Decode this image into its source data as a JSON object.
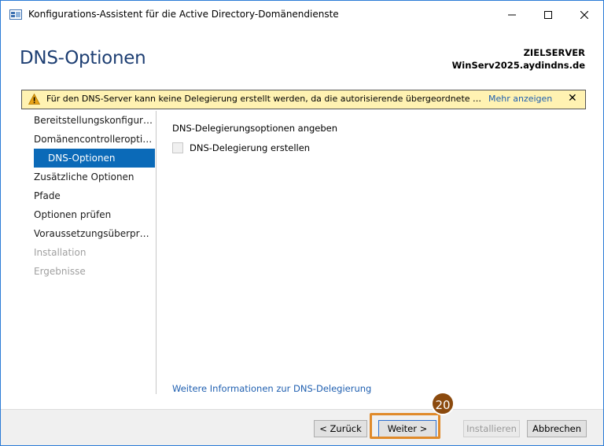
{
  "window": {
    "title": "Konfigurations-Assistent für die Active Directory-Domänendienste"
  },
  "header": {
    "page_title": "DNS-Optionen",
    "target_label": "ZIELSERVER",
    "target_name": "WinServ2025.aydindns.de"
  },
  "warning": {
    "text": "Für den DNS-Server kann keine Delegierung erstellt werden, da die autorisierende übergeordnete Zone...",
    "more_link": "Mehr anzeigen",
    "close": "✕"
  },
  "nav": {
    "items": [
      {
        "label": "Bereitstellungskonfiguration",
        "state": "normal"
      },
      {
        "label": "Domänencontrolleroptionen",
        "state": "normal"
      },
      {
        "label": "DNS-Optionen",
        "state": "active"
      },
      {
        "label": "Zusätzliche Optionen",
        "state": "normal"
      },
      {
        "label": "Pfade",
        "state": "normal"
      },
      {
        "label": "Optionen prüfen",
        "state": "normal"
      },
      {
        "label": "Voraussetzungsüberprüfung",
        "state": "normal"
      },
      {
        "label": "Installation",
        "state": "disabled"
      },
      {
        "label": "Ergebnisse",
        "state": "disabled"
      }
    ]
  },
  "content": {
    "section_title": "DNS-Delegierungsoptionen angeben",
    "checkbox_label": "DNS-Delegierung erstellen",
    "more_info_link": "Weitere Informationen zur DNS-Delegierung"
  },
  "footer": {
    "back_label": "< Zurück",
    "next_label": "Weiter >",
    "install_label": "Installieren",
    "cancel_label": "Abbrechen"
  },
  "annotation": {
    "step_number": "20"
  },
  "colors": {
    "accent": "#0b6ab8",
    "title_blue": "#1e3f73",
    "warning_bg": "#fff2b2",
    "highlight_orange": "#e08a2a",
    "badge_brown": "#8b4a0e"
  }
}
